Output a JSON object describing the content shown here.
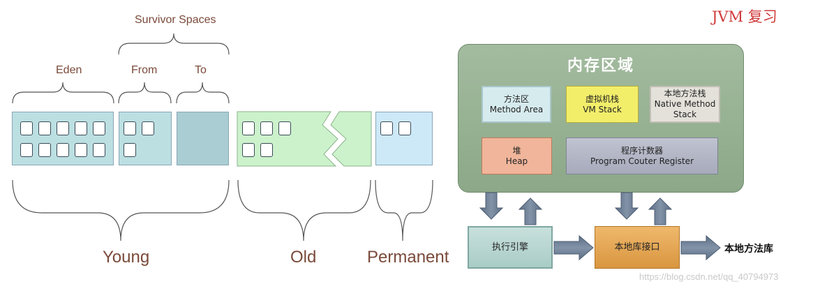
{
  "heap_diagram": {
    "survivor_label": "Survivor Spaces",
    "eden_label": "Eden",
    "from_label": "From",
    "to_label": "To",
    "young_label": "Young",
    "old_label": "Old",
    "permanent_label": "Permanent"
  },
  "memory_diagram": {
    "heading": "JVM 复习",
    "region_title": "内存区域",
    "method_area": {
      "cn": "方法区",
      "en": "Method Area"
    },
    "vm_stack": {
      "cn": "虚拟机栈",
      "en": "VM Stack"
    },
    "native_stack": {
      "cn": "本地方法栈",
      "en1": "Native Method",
      "en2": "Stack"
    },
    "heap": {
      "cn": "堆",
      "en": "Heap"
    },
    "pc_register": {
      "cn": "程序计数器",
      "en": "Program Couter Register"
    },
    "execution_engine": "执行引擎",
    "native_interface": "本地库接口",
    "native_library": "本地方法库"
  },
  "watermark": "https://blog.csdn.net/qq_40794973",
  "colors": {
    "young": "#bcdfe2",
    "old": "#ccf2cc",
    "permanent": "#cde9f8",
    "memory_region": "#98b295",
    "method_area": "#d6ebee",
    "vm_stack": "#f2ee6a",
    "native_stack": "#e4e1da",
    "heap": "#f0b59a",
    "pc_register": "#b0b4c4",
    "execution_engine": "#b5d4d0",
    "native_interface": "#e5a85a",
    "title": "#d03a3a"
  }
}
